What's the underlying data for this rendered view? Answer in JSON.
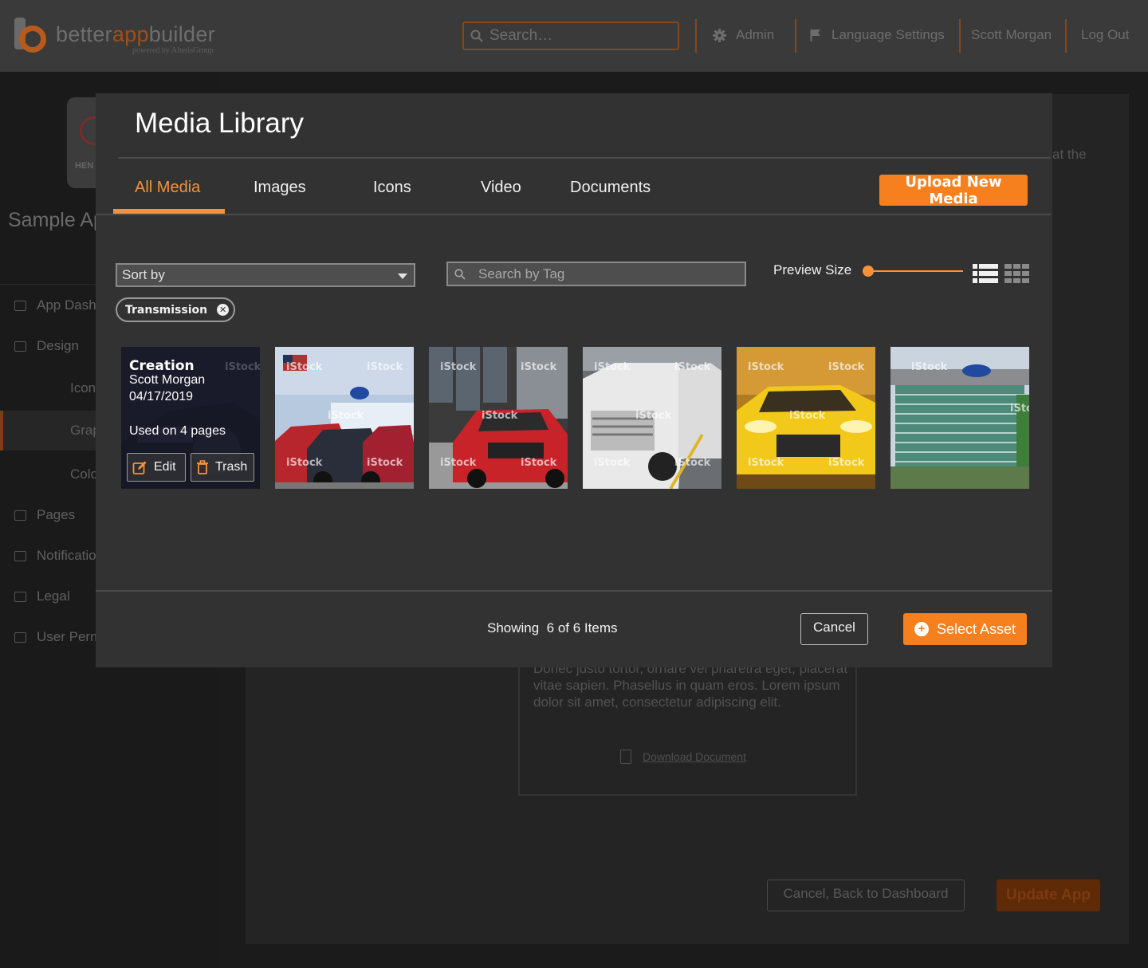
{
  "brand": {
    "name_prefix": "better",
    "name_accent": "app",
    "name_suffix": "builder",
    "tagline": "powered by AlterisGroup",
    "accent_color": "#f7801e"
  },
  "topbar": {
    "search_placeholder": "Search…",
    "admin_label": "Admin",
    "language_label": "Language Settings",
    "user_name": "Scott Morgan",
    "logout_label": "Log Out"
  },
  "sidebar": {
    "app_card_label": "HEN",
    "app_title": "Sample Ap",
    "items": [
      {
        "label": "App Dash",
        "icon": "home-icon"
      },
      {
        "label": "Design",
        "icon": "image-icon"
      },
      {
        "label": "Pages",
        "icon": "pages-icon"
      },
      {
        "label": "Notificatio",
        "icon": "mail-icon"
      },
      {
        "label": "Legal",
        "icon": "scale-icon"
      },
      {
        "label": "User Perm",
        "icon": "lock-icon"
      }
    ],
    "subitems": [
      {
        "label": "Icon"
      },
      {
        "label": "Grap"
      },
      {
        "label": "Colo"
      }
    ]
  },
  "background": {
    "fragment_text": "at the",
    "doc_text": "Donec justo tortor, ornare vel pharetra eget, placerat vitae sapien. Phasellus in quam eros. Lorem ipsum dolor sit amet, consectetur adipiscing elit.",
    "download_label": "Download Document",
    "back_button": "Cancel, Back to Dashboard",
    "update_button": "Update App"
  },
  "modal": {
    "title": "Media Library",
    "tabs": [
      {
        "label": "All Media",
        "active": true
      },
      {
        "label": "Images",
        "active": false
      },
      {
        "label": "Icons",
        "active": false
      },
      {
        "label": "Video",
        "active": false
      },
      {
        "label": "Documents",
        "active": false
      }
    ],
    "upload_button": "Upload New Media",
    "sort_placeholder": "Sort by",
    "tag_search_placeholder": "Search by Tag",
    "preview_size_label": "Preview Size",
    "preview_size_value": 0,
    "active_tag": "Transmission",
    "media_items": [
      {
        "caption_title": "Creation",
        "author": "Scott Morgan",
        "date": "04/17/2019",
        "usage": "Used on 4 pages",
        "edit_label": "Edit",
        "trash_label": "Trash",
        "watermark": "iStock"
      },
      {
        "subject": "cars at Ford dealership",
        "watermark": "iStock"
      },
      {
        "subject": "red Ford car",
        "watermark": "iStock"
      },
      {
        "subject": "white Ford trucks",
        "watermark": "iStock"
      },
      {
        "subject": "yellow Ford Mustang",
        "watermark": "iStock"
      },
      {
        "subject": "Ford headquarters building",
        "watermark": "iStock"
      }
    ],
    "showing_prefix": "Showing",
    "showing_count": "6 of 6 Items",
    "cancel_button": "Cancel",
    "select_button": "Select Asset"
  }
}
